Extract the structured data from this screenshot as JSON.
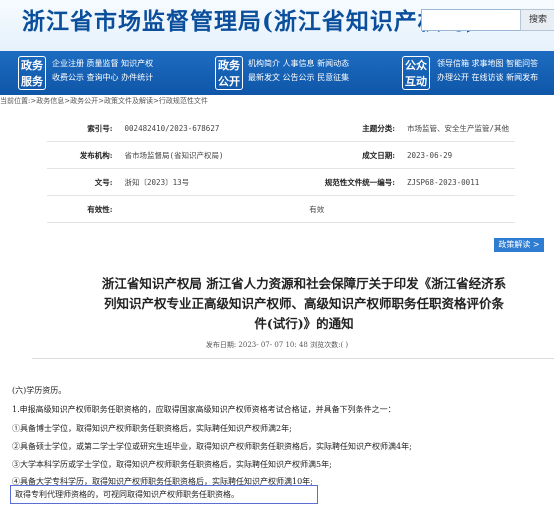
{
  "header": {
    "title": "浙江省市场监督管理局(浙江省知识产权局)",
    "search_placeholder": "",
    "search_button": "搜索"
  },
  "nav": {
    "groups": [
      {
        "badge": [
          "政务",
          "服务"
        ],
        "row1": "企业注册  质量监督  知识产权",
        "row2": "收费公示  查询中心  办件统计"
      },
      {
        "badge": [
          "政务",
          "公开"
        ],
        "row1": "机构简介  人事信息  新闻动态",
        "row2": "最新发文  公告公示  民意征集"
      },
      {
        "badge": [
          "公众",
          "互动"
        ],
        "row1": "领导信箱  求事地图  智能问答",
        "row2": "办理公开  在线访谈  新闻发布"
      }
    ]
  },
  "breadcrumb": "当前位置:>政务信息>政务公开>政策文件及解读>行政规范性文件",
  "meta": {
    "index_label": "索引号:",
    "index_value": "002482410/2023-678627",
    "topic_label": "主题分类:",
    "topic_value": "市场监管、安全生产监管/其他",
    "issuer_label": "发布机构:",
    "issuer_value": "省市场监督局(省知识产权局)",
    "date_label": "成文日期:",
    "date_value": "2023-06-29",
    "docno_label": "文号:",
    "docno_value": "浙知〔2023〕13号",
    "uniform_label": "规范性文件统一编号:",
    "uniform_value": "ZJSP68-2023-0011",
    "valid_label": "有效性:",
    "valid_value": "有效"
  },
  "policy_button": "政策解读 >",
  "document": {
    "title": "浙江省知识产权局 浙江省人力资源和社会保障厅关于印发《浙江省经济系列知识产权专业正高级知识产权师、高级知识产权师职务任职资格评价条件(试行)》的通知",
    "meta_line": "发布日期: 2023- 07- 07 10: 48 浏览次数:( )"
  },
  "body": {
    "section": "(六)学历资历。",
    "para1": "1.申报高级知识产权师职务任职资格的，应取得国家高级知识产权师资格考试合格证，并具备下列条件之一：",
    "item1": "①具备博士学位，取得知识产权师职务任职资格后，实际聘任知识产权师满2年;",
    "item2": "②具备硕士学位，或第二学士学位或研究生班毕业，取得知识产权师职务任职资格后，实际聘任知识产权师满4年;",
    "item3": "③大学本科学历或学士学位，取得知识产权师职务任职资格后，实际聘任知识产权师满5年;",
    "item4": "④具备大学专科学历，取得知识产权师职务任职资格后，实际聘任知识产权师满10年;",
    "highlight": "取得专利代理师资格的，可视同取得知识产权师职务任职资格。"
  }
}
